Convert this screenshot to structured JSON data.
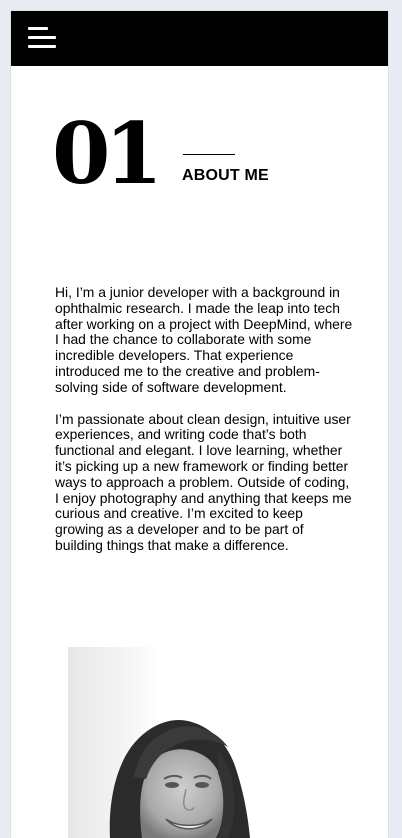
{
  "header": {
    "menu_icon": "hamburger-menu-icon"
  },
  "about": {
    "number": "01",
    "title": "ABOUT ME",
    "paragraphs": [
      "Hi, I’m a junior developer with a background in ophthalmic research. I made the leap into tech after working on a project with DeepMind, where I had the chance to collaborate with some incredible developers. That experience introduced me to the creative and problem-solving side of software development.",
      "I’m passionate about clean design, intuitive user experiences, and writing code that’s both functional and elegant. I love learning, whether it’s picking up a new framework or finding better ways to approach a problem. Outside of coding, I enjoy photography and anything that keeps me curious and creative. I’m excited to keep growing as a developer and to be part of building things that make a difference."
    ]
  },
  "colors": {
    "page_background": "#e9ebf3",
    "header_background": "#000000",
    "card_background": "#ffffff",
    "text": "#000000"
  }
}
